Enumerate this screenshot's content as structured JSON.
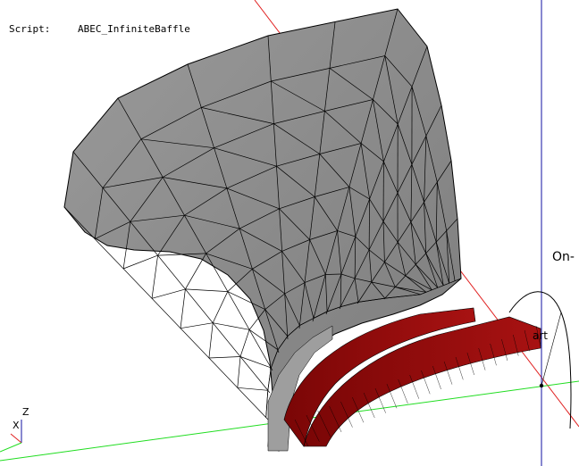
{
  "script": {
    "label": "Script:",
    "value": "ABEC_InfiniteBaffle"
  },
  "labels": {
    "side_label": "On-",
    "part_label": "art"
  },
  "axes": {
    "z_label": "Z",
    "x_label": "X"
  },
  "colors": {
    "background": "#ffffff",
    "horn_fill": "#8c8c8c",
    "driver_fill": "#9b0d0d",
    "mesh_edge": "#000000",
    "x_axis_line": "#e02020",
    "y_axis_line": "#20dd20",
    "z_axis_line": "#1010a0"
  }
}
